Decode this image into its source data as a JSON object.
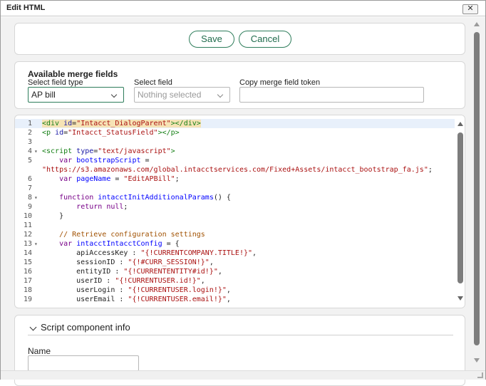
{
  "dialog": {
    "title": "Edit HTML",
    "close_glyph": "✕"
  },
  "actions": {
    "save_label": "Save",
    "cancel_label": "Cancel"
  },
  "merge": {
    "heading": "Available merge fields",
    "field_type_label": "Select field type",
    "field_type_value": "AP bill",
    "field_label": "Select field",
    "field_value": "Nothing selected",
    "token_label": "Copy merge field token",
    "token_value": ""
  },
  "code": {
    "lines": [
      {
        "n": "1",
        "fold": "",
        "hl": true,
        "segs": [
          [
            "tag",
            "<div "
          ],
          [
            "attr",
            "id"
          ],
          [
            "plain",
            "="
          ],
          [
            "str",
            "\"Intacct_DialogParent\""
          ],
          [
            "tag",
            "></div>"
          ]
        ]
      },
      {
        "n": "2",
        "fold": "",
        "segs": [
          [
            "tag",
            "<p "
          ],
          [
            "attr",
            "id"
          ],
          [
            "plain",
            "="
          ],
          [
            "str",
            "\"Intacct_StatusField\""
          ],
          [
            "tag",
            "></p>"
          ]
        ]
      },
      {
        "n": "3",
        "fold": "",
        "segs": []
      },
      {
        "n": "4",
        "fold": "▾",
        "segs": [
          [
            "tag",
            "<script "
          ],
          [
            "attr",
            "type"
          ],
          [
            "plain",
            "="
          ],
          [
            "str",
            "\"text/javascript\""
          ],
          [
            "tag",
            ">"
          ]
        ]
      },
      {
        "n": "5",
        "fold": "",
        "segs": [
          [
            "plain",
            "    "
          ],
          [
            "kw",
            "var"
          ],
          [
            "plain",
            " "
          ],
          [
            "def",
            "bootstrapScript"
          ],
          [
            "plain",
            " ="
          ]
        ]
      },
      {
        "n": "",
        "fold": "",
        "segs": [
          [
            "str",
            "\"https://s3.amazonaws.com/global.intacctservices.com/Fixed+Assets/intacct_bootstrap_fa.js\""
          ],
          [
            "plain",
            ";"
          ]
        ]
      },
      {
        "n": "6",
        "fold": "",
        "segs": [
          [
            "plain",
            "    "
          ],
          [
            "kw",
            "var"
          ],
          [
            "plain",
            " "
          ],
          [
            "def",
            "pageName"
          ],
          [
            "plain",
            " = "
          ],
          [
            "str",
            "\"EditAPBill\""
          ],
          [
            "plain",
            ";"
          ]
        ]
      },
      {
        "n": "7",
        "fold": "",
        "segs": []
      },
      {
        "n": "8",
        "fold": "▾",
        "segs": [
          [
            "plain",
            "    "
          ],
          [
            "kw",
            "function"
          ],
          [
            "plain",
            " "
          ],
          [
            "def",
            "intacctInitAdditionalParams"
          ],
          [
            "plain",
            "() {"
          ]
        ]
      },
      {
        "n": "9",
        "fold": "",
        "segs": [
          [
            "plain",
            "        "
          ],
          [
            "kw",
            "return"
          ],
          [
            "plain",
            " "
          ],
          [
            "kw",
            "null"
          ],
          [
            "plain",
            ";"
          ]
        ]
      },
      {
        "n": "10",
        "fold": "",
        "segs": [
          [
            "plain",
            "    }"
          ]
        ]
      },
      {
        "n": "11",
        "fold": "",
        "segs": []
      },
      {
        "n": "12",
        "fold": "",
        "segs": [
          [
            "plain",
            "    "
          ],
          [
            "com",
            "// Retrieve configuration settings"
          ]
        ]
      },
      {
        "n": "13",
        "fold": "▾",
        "segs": [
          [
            "plain",
            "    "
          ],
          [
            "kw",
            "var"
          ],
          [
            "plain",
            " "
          ],
          [
            "def",
            "intacctIntacctConfig"
          ],
          [
            "plain",
            " = {"
          ]
        ]
      },
      {
        "n": "14",
        "fold": "",
        "segs": [
          [
            "plain",
            "        apiAccessKey : "
          ],
          [
            "str",
            "\"{!CURRENTCOMPANY.TITLE!}\""
          ],
          [
            "plain",
            ","
          ]
        ]
      },
      {
        "n": "15",
        "fold": "",
        "segs": [
          [
            "plain",
            "        sessionID : "
          ],
          [
            "str",
            "\"{!#CURR_SESSION!}\""
          ],
          [
            "plain",
            ","
          ]
        ]
      },
      {
        "n": "16",
        "fold": "",
        "segs": [
          [
            "plain",
            "        entityID : "
          ],
          [
            "str",
            "\"{!CURRENTENTITY#id!}\""
          ],
          [
            "plain",
            ","
          ]
        ]
      },
      {
        "n": "17",
        "fold": "",
        "segs": [
          [
            "plain",
            "        userID : "
          ],
          [
            "str",
            "\"{!CURRENTUSER.id!}\""
          ],
          [
            "plain",
            ","
          ]
        ]
      },
      {
        "n": "18",
        "fold": "",
        "segs": [
          [
            "plain",
            "        userLogin : "
          ],
          [
            "str",
            "\"{!CURRENTUSER.login!}\""
          ],
          [
            "plain",
            ","
          ]
        ]
      },
      {
        "n": "19",
        "fold": "",
        "segs": [
          [
            "plain",
            "        userEmail : "
          ],
          [
            "str",
            "\"{!CURRENTUSER.email!}\""
          ],
          [
            "plain",
            ","
          ]
        ]
      }
    ]
  },
  "script_info": {
    "heading": "Script component info",
    "name_label": "Name",
    "name_value": ""
  }
}
